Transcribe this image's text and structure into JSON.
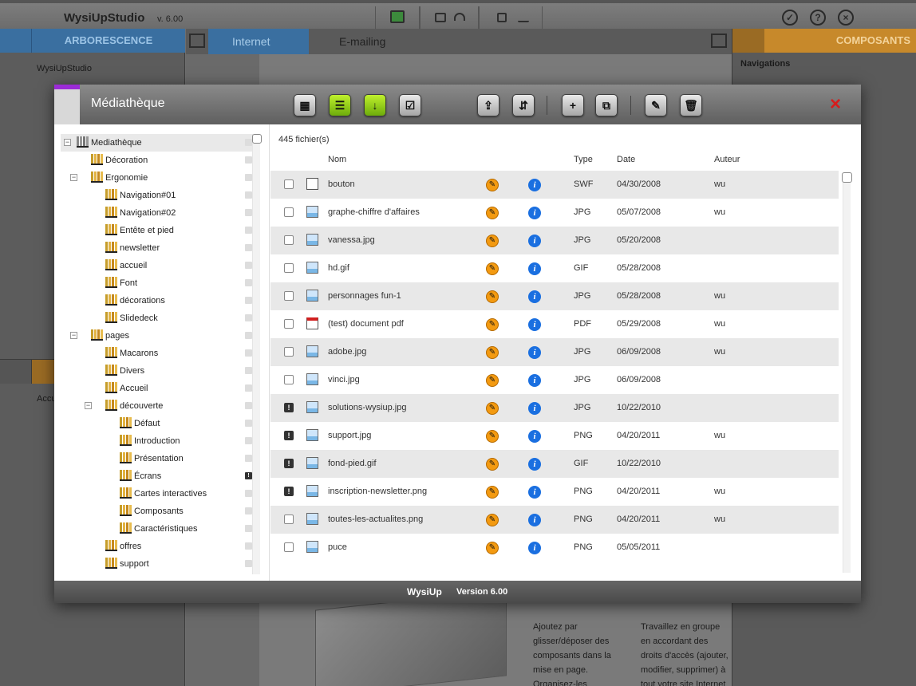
{
  "app": {
    "name": "WysiUpStudio",
    "version": "v. 6.00"
  },
  "left_panel": {
    "header": "ARBORESCENCE",
    "root_item": "WysiUpStudio",
    "bottom_item": "Accu"
  },
  "center": {
    "tabs": [
      {
        "label": "Internet"
      },
      {
        "label": "E-mailing"
      }
    ],
    "promo_left": "Ajoutez par glisser/déposer des composants dans la mise en page. Organisez-les",
    "promo_right": "Travaillez en groupe en accordant des droits d'accès (ajouter, modifier, supprimer) à tout votre site Internet"
  },
  "right_panel": {
    "header": "COMPOSANTS",
    "nav_label": "Navigations"
  },
  "modal": {
    "title": "Médiathèque",
    "close_icon": "×",
    "toolbar": [
      {
        "name": "grid-view-button",
        "icon": "grid-icon",
        "glyph": "▦"
      },
      {
        "name": "list-view-button",
        "icon": "list-icon",
        "glyph": "☰"
      },
      {
        "name": "download-button",
        "icon": "arrow-down-icon",
        "glyph": "↓"
      },
      {
        "name": "select-button",
        "icon": "checkbox-icon",
        "glyph": "☑"
      },
      {
        "name": "upload-button",
        "icon": "upload-icon",
        "glyph": "⇪"
      },
      {
        "name": "zip-button",
        "icon": "zip-icon",
        "glyph": "⇵"
      },
      {
        "name": "new-folder-button",
        "icon": "new-folder-icon",
        "glyph": "+"
      },
      {
        "name": "duplicate-button",
        "icon": "duplicate-icon",
        "glyph": "⧉"
      },
      {
        "name": "edit-button",
        "icon": "edit-icon",
        "glyph": "✎"
      },
      {
        "name": "delete-button",
        "icon": "trash-icon",
        "glyph": "🗑"
      }
    ],
    "tree": [
      {
        "label": "Mediathèque",
        "level": 0,
        "toggle": "−",
        "root": true,
        "selected": true
      },
      {
        "label": "Décoration",
        "level": 1
      },
      {
        "label": "Ergonomie",
        "level": 1,
        "toggle": "−"
      },
      {
        "label": "Navigation#01",
        "level": 2
      },
      {
        "label": "Navigation#02",
        "level": 2
      },
      {
        "label": "Entête et pied",
        "level": 2
      },
      {
        "label": "newsletter",
        "level": 2
      },
      {
        "label": "accueil",
        "level": 2
      },
      {
        "label": "Font",
        "level": 2
      },
      {
        "label": "décorations",
        "level": 2
      },
      {
        "label": "Slidedeck",
        "level": 2
      },
      {
        "label": "pages",
        "level": 1,
        "toggle": "−"
      },
      {
        "label": "Macarons",
        "level": 2
      },
      {
        "label": "Divers",
        "level": 2
      },
      {
        "label": "Accueil",
        "level": 2
      },
      {
        "label": "découverte",
        "level": 2,
        "toggle": "−"
      },
      {
        "label": "Défaut",
        "level": 3
      },
      {
        "label": "Introduction",
        "level": 3
      },
      {
        "label": "Présentation",
        "level": 3
      },
      {
        "label": "Écrans",
        "level": 3,
        "flag": "!"
      },
      {
        "label": "Cartes interactives",
        "level": 3
      },
      {
        "label": "Composants",
        "level": 3
      },
      {
        "label": "Caractéristiques",
        "level": 3
      },
      {
        "label": "offres",
        "level": 2
      },
      {
        "label": "support",
        "level": 2
      }
    ],
    "file_count": "445 fichier(s)",
    "columns": {
      "name": "Nom",
      "type": "Type",
      "date": "Date",
      "author": "Auteur"
    },
    "files": [
      {
        "name": "bouton",
        "type": "SWF",
        "date": "04/30/2008",
        "author": "wu",
        "kind": "doc"
      },
      {
        "name": "graphe-chiffre d'affaires",
        "type": "JPG",
        "date": "05/07/2008",
        "author": "wu",
        "kind": "img"
      },
      {
        "name": "vanessa.jpg",
        "type": "JPG",
        "date": "05/20/2008",
        "author": "",
        "kind": "img"
      },
      {
        "name": "hd.gif",
        "type": "GIF",
        "date": "05/28/2008",
        "author": "",
        "kind": "img"
      },
      {
        "name": "personnages fun-1",
        "type": "JPG",
        "date": "05/28/2008",
        "author": "wu",
        "kind": "img"
      },
      {
        "name": "(test) document pdf",
        "type": "PDF",
        "date": "05/29/2008",
        "author": "wu",
        "kind": "pdf"
      },
      {
        "name": "adobe.jpg",
        "type": "JPG",
        "date": "06/09/2008",
        "author": "wu",
        "kind": "img"
      },
      {
        "name": "vinci.jpg",
        "type": "JPG",
        "date": "06/09/2008",
        "author": "",
        "kind": "img"
      },
      {
        "name": "solutions-wysiup.jpg",
        "type": "JPG",
        "date": "10/22/2010",
        "author": "",
        "kind": "img",
        "warn": true
      },
      {
        "name": "support.jpg",
        "type": "PNG",
        "date": "04/20/2011",
        "author": "wu",
        "kind": "img",
        "warn": true
      },
      {
        "name": "fond-pied.gif",
        "type": "GIF",
        "date": "10/22/2010",
        "author": "",
        "kind": "img",
        "warn": true
      },
      {
        "name": "inscription-newsletter.png",
        "type": "PNG",
        "date": "04/20/2011",
        "author": "wu",
        "kind": "img",
        "warn": true
      },
      {
        "name": "toutes-les-actualites.png",
        "type": "PNG",
        "date": "04/20/2011",
        "author": "wu",
        "kind": "img"
      },
      {
        "name": "puce",
        "type": "PNG",
        "date": "05/05/2011",
        "author": "",
        "kind": "img"
      }
    ],
    "footer": {
      "brand": "WysiUp",
      "version": "Version 6.00"
    }
  }
}
